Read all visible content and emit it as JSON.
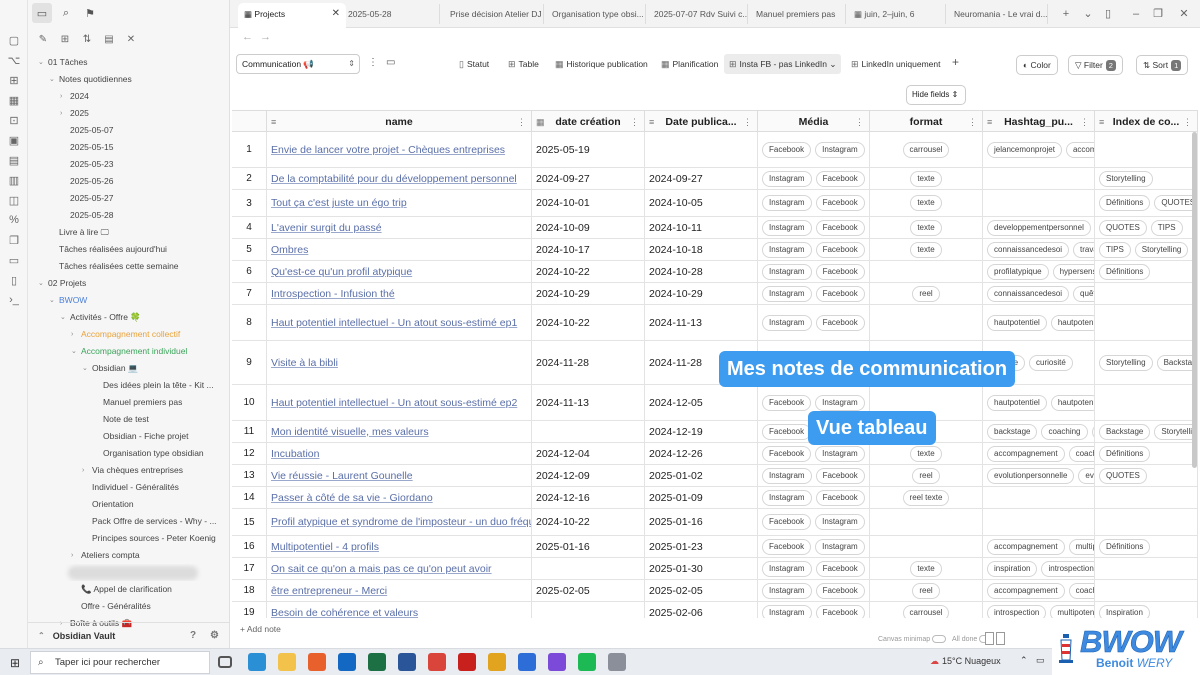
{
  "colors": {
    "accent": "#3d9cf0",
    "link": "#5a6fa8",
    "orange": "#e8a23a",
    "green": "#3aa35a",
    "blue": "#4a7fd8"
  },
  "ribbon_icons": [
    "files-icon",
    "graph-icon",
    "canvas-icon",
    "calendar-icon",
    "template-icon",
    "daily-note-icon",
    "table-icon",
    "kanban-icon",
    "publish-icon",
    "percent-icon",
    "copy-icon",
    "document-icon",
    "clipboard-icon",
    "terminal-icon"
  ],
  "sidebar": {
    "tree": [
      {
        "label": "01 Tâches",
        "level": 0,
        "chev": "down"
      },
      {
        "label": "Notes quotidiennes",
        "level": 1,
        "chev": "down"
      },
      {
        "label": "2024",
        "level": 2,
        "chev": "right"
      },
      {
        "label": "2025",
        "level": 2,
        "chev": "right"
      },
      {
        "label": "2025-05-07",
        "level": 2
      },
      {
        "label": "2025-05-15",
        "level": 2
      },
      {
        "label": "2025-05-23",
        "level": 2
      },
      {
        "label": "2025-05-26",
        "level": 2
      },
      {
        "label": "2025-05-27",
        "level": 2
      },
      {
        "label": "2025-05-28",
        "level": 2
      },
      {
        "label": "Livre à lire 🖵",
        "level": 1
      },
      {
        "label": "Tâches réalisées aujourd'hui",
        "level": 1
      },
      {
        "label": "Tâches réalisées cette semaine",
        "level": 1
      },
      {
        "label": "02 Projets",
        "level": 0,
        "chev": "down"
      },
      {
        "label": "BWOW",
        "level": 1,
        "chev": "down",
        "color": "blue"
      },
      {
        "label": "Activités - Offre 🍀",
        "level": 2,
        "chev": "down"
      },
      {
        "label": "Accompagnement collectif",
        "level": 3,
        "chev": "right",
        "color": "orange"
      },
      {
        "label": "Accompagnement individuel",
        "level": 3,
        "chev": "down",
        "color": "green"
      },
      {
        "label": "Obsidian 💻",
        "level": 4,
        "chev": "down"
      },
      {
        "label": "Des idées plein la tête - Kit ...",
        "level": 5
      },
      {
        "label": "Manuel premiers pas",
        "level": 5
      },
      {
        "label": "Note de test",
        "level": 5
      },
      {
        "label": "Obsidian - Fiche projet",
        "level": 5
      },
      {
        "label": "Organisation type obsidian",
        "level": 5
      },
      {
        "label": "Via chèques entreprises",
        "level": 4,
        "chev": "right"
      },
      {
        "label": "Individuel - Généralités",
        "level": 4
      },
      {
        "label": "Orientation",
        "level": 4
      },
      {
        "label": "Pack Offre de services - Why - ...",
        "level": 4
      },
      {
        "label": "Principes sources - Peter Koenig",
        "level": 4
      },
      {
        "label": "Ateliers compta",
        "level": 3,
        "chev": "right"
      },
      {
        "label": "",
        "level": 3,
        "chev": "right",
        "blur": true
      },
      {
        "label": "📞 Appel de clarification",
        "level": 3
      },
      {
        "label": "Offre - Généralités",
        "level": 3
      },
      {
        "label": "Boîte à outils 🧰",
        "level": 2,
        "chev": "right"
      }
    ],
    "vault_name": "Obsidian Vault"
  },
  "tabs": [
    {
      "label": "Projects",
      "active": true
    },
    {
      "label": "2025-05-28"
    },
    {
      "label": "Prise décision Atelier DJ"
    },
    {
      "label": "Organisation type obsi..."
    },
    {
      "label": "2025-07-07 Rdv Suivi c..."
    },
    {
      "label": "Manuel premiers pas"
    },
    {
      "label": "juin, 2–juin, 6"
    },
    {
      "label": "Neuromania - Le vrai d..."
    }
  ],
  "toolbar": {
    "base": "Communication 📢",
    "views": [
      "Statut",
      "Table",
      "Historique publication",
      "Planification",
      "Insta FB - pas LinkedIn",
      "LinkedIn uniquement"
    ],
    "active_view": 4,
    "color_label": "Color",
    "filter_label": "Filter",
    "filter_count": "2",
    "sort_label": "Sort",
    "sort_count": "1",
    "hide_fields": "Hide fields"
  },
  "table": {
    "columns": [
      "name",
      "date création",
      "Date publica...",
      "Média",
      "format",
      "Hashtag_pu...",
      "Index de co..."
    ],
    "rows": [
      {
        "n": "1",
        "name": "Envie de lancer votre projet - Chèques entreprises",
        "created": "2025-05-19",
        "published": "",
        "media": [
          "Facebook",
          "Instagram"
        ],
        "format": "carrousel",
        "hashtags": [
          "jelancemonprojet",
          "accom"
        ],
        "index": []
      },
      {
        "n": "2",
        "name": "De la comptabilité pour du développement personnel",
        "created": "2024-09-27",
        "published": "2024-09-27",
        "media": [
          "Instagram",
          "Facebook"
        ],
        "format": "texte",
        "hashtags": [],
        "index": [
          "Storytelling"
        ]
      },
      {
        "n": "3",
        "name": "Tout ça c'est juste un égo trip",
        "created": "2024-10-01",
        "published": "2024-10-05",
        "media": [
          "Instagram",
          "Facebook"
        ],
        "format": "texte",
        "hashtags": [],
        "index": [
          "Définitions",
          "QUOTES"
        ]
      },
      {
        "n": "4",
        "name": "L'avenir surgit du passé",
        "created": "2024-10-09",
        "published": "2024-10-11",
        "media": [
          "Instagram",
          "Facebook"
        ],
        "format": "texte",
        "hashtags": [
          "developpementpersonnel"
        ],
        "index": [
          "QUOTES",
          "TIPS"
        ]
      },
      {
        "n": "5",
        "name": "Ombres",
        "created": "2024-10-17",
        "published": "2024-10-18",
        "media": [
          "Instagram",
          "Facebook"
        ],
        "format": "texte",
        "hashtags": [
          "connaissancedesoi",
          "trava"
        ],
        "index": [
          "TIPS",
          "Storytelling",
          "Défi"
        ]
      },
      {
        "n": "6",
        "name": "Qu'est-ce qu'un profil atypique",
        "created": "2024-10-22",
        "published": "2024-10-28",
        "media": [
          "Instagram",
          "Facebook"
        ],
        "format": "",
        "hashtags": [
          "profilatypique",
          "hypersens"
        ],
        "index": [
          "Définitions"
        ]
      },
      {
        "n": "7",
        "name": "Introspection - Infusion thé",
        "created": "2024-10-29",
        "published": "2024-10-29",
        "media": [
          "Instagram",
          "Facebook"
        ],
        "format": "reel",
        "hashtags": [
          "connaissancedesoi",
          "quête"
        ],
        "index": []
      },
      {
        "n": "8",
        "name": "Haut potentiel intellectuel - Un atout sous-estimé ep1",
        "created": "2024-10-22",
        "published": "2024-11-13",
        "media": [
          "Instagram",
          "Facebook"
        ],
        "format": "",
        "hashtags": [
          "hautpotentiel",
          "hautpoten"
        ],
        "index": []
      },
      {
        "n": "9",
        "name": "Visite à la bibli",
        "created": "2024-11-28",
        "published": "2024-11-28",
        "media": [],
        "format": "",
        "hashtags": [
          "lecture",
          "curiosité"
        ],
        "index": [
          "Storytelling",
          "Backstage"
        ]
      },
      {
        "n": "10",
        "name": "Haut potentiel intellectuel - Un atout sous-estimé ep2",
        "created": "2024-11-13",
        "published": "2024-12-05",
        "media": [
          "Facebook",
          "Instagram"
        ],
        "format": "",
        "hashtags": [
          "hautpotentiel",
          "hautpoten"
        ],
        "index": []
      },
      {
        "n": "11",
        "name": "Mon identité visuelle, mes valeurs",
        "created": "",
        "published": "2024-12-19",
        "media": [
          "Facebook"
        ],
        "format": "",
        "hashtags": [
          "backstage",
          "coaching",
          "a"
        ],
        "index": [
          "Backstage",
          "Storytellin"
        ]
      },
      {
        "n": "12",
        "name": "Incubation",
        "created": "2024-12-04",
        "published": "2024-12-26",
        "media": [
          "Facebook",
          "Instagram"
        ],
        "format": "texte",
        "hashtags": [
          "accompagnement",
          "coach"
        ],
        "index": [
          "Définitions"
        ]
      },
      {
        "n": "13",
        "name": "Vie réussie - Laurent Gounelle",
        "created": "2024-12-09",
        "published": "2025-01-02",
        "media": [
          "Instagram",
          "Facebook"
        ],
        "format": "reel",
        "hashtags": [
          "evolutionpersonnelle",
          "ev"
        ],
        "index": [
          "QUOTES"
        ]
      },
      {
        "n": "14",
        "name": "Passer à côté de sa vie - Giordano",
        "created": "2024-12-16",
        "published": "2025-01-09",
        "media": [
          "Instagram",
          "Facebook"
        ],
        "format": "reel texte",
        "hashtags": [],
        "index": []
      },
      {
        "n": "15",
        "name": "Profil atypique et syndrome de l'imposteur - un duo fréquent",
        "created": "2024-10-22",
        "published": "2025-01-16",
        "media": [
          "Facebook",
          "Instagram"
        ],
        "format": "",
        "hashtags": [],
        "index": []
      },
      {
        "n": "16",
        "name": "Multipotentiel - 4 profils",
        "created": "2025-01-16",
        "published": "2025-01-23",
        "media": [
          "Facebook",
          "Instagram"
        ],
        "format": "",
        "hashtags": [
          "accompagnement",
          "multip"
        ],
        "index": [
          "Définitions"
        ]
      },
      {
        "n": "17",
        "name": "On sait ce qu'on a mais pas ce qu'on peut avoir",
        "created": "",
        "published": "2025-01-30",
        "media": [
          "Instagram",
          "Facebook"
        ],
        "format": "texte",
        "hashtags": [
          "inspiration",
          "introspection"
        ],
        "index": []
      },
      {
        "n": "18",
        "name": "être entrepreneur - Merci",
        "created": "2025-02-05",
        "published": "2025-02-05",
        "media": [
          "Instagram",
          "Facebook"
        ],
        "format": "reel",
        "hashtags": [
          "accompagnement",
          "coach"
        ],
        "index": []
      },
      {
        "n": "19",
        "name": "Besoin de cohérence et valeurs",
        "created": "",
        "published": "2025-02-06",
        "media": [
          "Instagram",
          "Facebook"
        ],
        "format": "carrousel",
        "hashtags": [
          "introspection",
          "multipoten"
        ],
        "index": [
          "Inspiration"
        ]
      }
    ]
  },
  "footer": {
    "add_note": "+ Add note",
    "canvas_minimap": "Canvas minimap",
    "all_done": "All done"
  },
  "overlays": {
    "title": "Mes notes de communication",
    "subtitle": "Vue tableau"
  },
  "logo": {
    "word": "BWOW",
    "first": "Benoit",
    "last": "WERY"
  },
  "taskbar": {
    "search_placeholder": "Taper ici pour rechercher",
    "weather": "15°C  Nuageux",
    "apps": [
      {
        "name": "task-view-icon",
        "color": "#555"
      },
      {
        "name": "edge-icon",
        "color": "#2b8fd6"
      },
      {
        "name": "explorer-icon",
        "color": "#f2c24b"
      },
      {
        "name": "firefox-icon",
        "color": "#e8612c"
      },
      {
        "name": "outlook-icon",
        "color": "#1368c4"
      },
      {
        "name": "excel-icon",
        "color": "#1d7044"
      },
      {
        "name": "word-icon",
        "color": "#2a5699"
      },
      {
        "name": "app-red-icon",
        "color": "#d9453b"
      },
      {
        "name": "acrobat-icon",
        "color": "#c8211d"
      },
      {
        "name": "chrome-icon",
        "color": "#e2a31f"
      },
      {
        "name": "app-blue-icon",
        "color": "#2d6dd8"
      },
      {
        "name": "obsidian-icon",
        "color": "#7c4ad8"
      },
      {
        "name": "spotify-icon",
        "color": "#1db954"
      },
      {
        "name": "app-gray-icon",
        "color": "#8a8f99"
      }
    ]
  }
}
